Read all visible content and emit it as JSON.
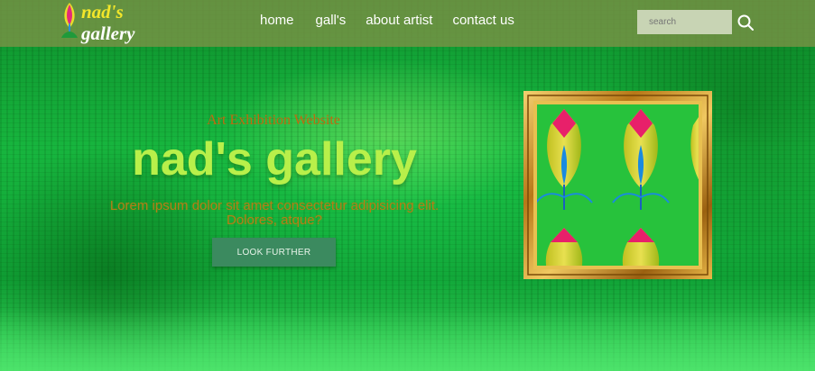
{
  "brand": {
    "line1": "nad's",
    "line2": "gallery"
  },
  "nav": {
    "items": [
      {
        "label": "home"
      },
      {
        "label": "gall's"
      },
      {
        "label": "about artist"
      },
      {
        "label": "contact us"
      }
    ],
    "search_placeholder": "search"
  },
  "hero": {
    "subtitle": "Art Exhibition Website",
    "title": "nad's gallery",
    "text_line1": "Lorem ipsum dolor sit amet consectetur adipisicing elit.",
    "text_line2": "Dolores, atque?",
    "cta_label": "LOOK FURTHER"
  },
  "colors": {
    "navbar": "#7e9246",
    "title": "#b8f04a",
    "subtitle": "#c06a10",
    "button": "#3b8a5f",
    "frame_gold": "#d9a028"
  },
  "icons": {
    "search": "search-icon",
    "logo": "tulip-flower-icon"
  }
}
